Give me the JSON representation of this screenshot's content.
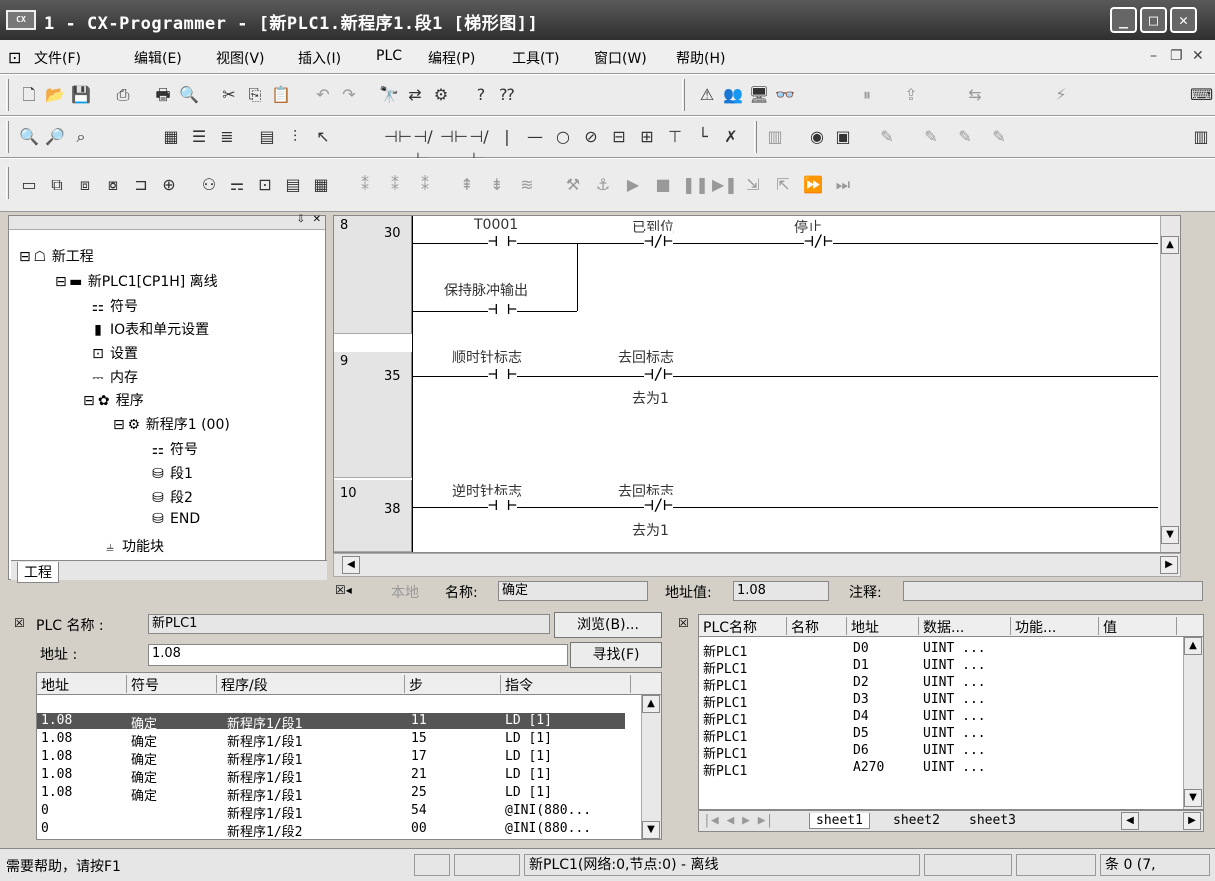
{
  "window": {
    "title": "1 - CX-Programmer - [新PLC1.新程序1.段1 [梯形图]]",
    "icon_label": "CX"
  },
  "menu": [
    "文件(F)",
    "编辑(E)",
    "视图(V)",
    "插入(I)",
    "PLC",
    "编程(P)",
    "工具(T)",
    "窗口(W)",
    "帮助(H)"
  ],
  "tree": {
    "nodes": [
      {
        "label": "新工程",
        "icon": "project-icon"
      },
      {
        "label": "新PLC1[CP1H] 离线",
        "icon": "plc-icon"
      },
      {
        "label": "符号",
        "icon": "symbols-icon"
      },
      {
        "label": "IO表和单元设置",
        "icon": "io-table-icon"
      },
      {
        "label": "设置",
        "icon": "settings-icon"
      },
      {
        "label": "内存",
        "icon": "memory-icon"
      },
      {
        "label": "程序",
        "icon": "programs-icon"
      },
      {
        "label": "新程序1 (00)",
        "icon": "program-icon"
      },
      {
        "label": "符号",
        "icon": "symbols-icon"
      },
      {
        "label": "段1",
        "icon": "section-icon"
      },
      {
        "label": "段2",
        "icon": "section-icon"
      },
      {
        "label": "END",
        "icon": "section-icon"
      },
      {
        "label": "功能块",
        "icon": "function-block-icon"
      }
    ],
    "tab": "工程"
  },
  "ladder": {
    "rungs": [
      {
        "num": "8",
        "step": "30"
      },
      {
        "num": "9",
        "step": "35"
      },
      {
        "num": "10",
        "step": "38"
      }
    ],
    "labels": {
      "t0001": "T0001",
      "arrived": "已到位",
      "stop": "停止",
      "hold_pulse": "保持脉冲输出",
      "cw_flag": "顺时针标志",
      "return_flag": "去回标志",
      "to_1": "去为1",
      "ccw_flag": "逆时针标志",
      "return_flag2": "去回标志",
      "to_1b": "去为1"
    }
  },
  "infobar": {
    "local": "本地",
    "name_label": "名称:",
    "name_value": "确定",
    "addr_label": "地址值:",
    "addr_value": "1.08",
    "comment_label": "注释:"
  },
  "xref": {
    "plc_label": "PLC 名称 :",
    "plc_value": "新PLC1",
    "addr_label": "地址 :",
    "addr_value": "1.08",
    "browse": "浏览(B)...",
    "find": "寻找(F)",
    "headers": [
      "地址",
      "符号",
      "程序/段",
      "步",
      "指令"
    ],
    "rows": [
      [
        "1.08",
        "确定",
        "新程序1/段1",
        "11",
        "LD [1]"
      ],
      [
        "1.08",
        "确定",
        "新程序1/段1",
        "15",
        "LD [1]"
      ],
      [
        "1.08",
        "确定",
        "新程序1/段1",
        "17",
        "LD [1]"
      ],
      [
        "1.08",
        "确定",
        "新程序1/段1",
        "21",
        "LD [1]"
      ],
      [
        "1.08",
        "确定",
        "新程序1/段1",
        "25",
        "LD [1]"
      ],
      [
        "0",
        "",
        "新程序1/段1",
        "54",
        "@INI(880..."
      ],
      [
        "0",
        "",
        "新程序1/段2",
        "00",
        "@INI(880..."
      ]
    ]
  },
  "watch": {
    "headers": [
      "PLC名称",
      "名称",
      "地址",
      "数据...",
      "功能...",
      "值"
    ],
    "rows": [
      [
        "新PLC1",
        "",
        "D0",
        "UINT ..."
      ],
      [
        "新PLC1",
        "",
        "D1",
        "UINT ..."
      ],
      [
        "新PLC1",
        "",
        "D2",
        "UINT ..."
      ],
      [
        "新PLC1",
        "",
        "D3",
        "UINT ..."
      ],
      [
        "新PLC1",
        "",
        "D4",
        "UINT ..."
      ],
      [
        "新PLC1",
        "",
        "D5",
        "UINT ..."
      ],
      [
        "新PLC1",
        "",
        "D6",
        "UINT ..."
      ],
      [
        "新PLC1",
        "",
        "A270",
        "UINT ..."
      ]
    ],
    "tabs": [
      "sheet1",
      "sheet2",
      "sheet3"
    ]
  },
  "statusbar": {
    "help": "需要帮助，请按F1",
    "network": "新PLC1(网络:0,节点:0) - 离线",
    "count": "条 0 (7,"
  }
}
